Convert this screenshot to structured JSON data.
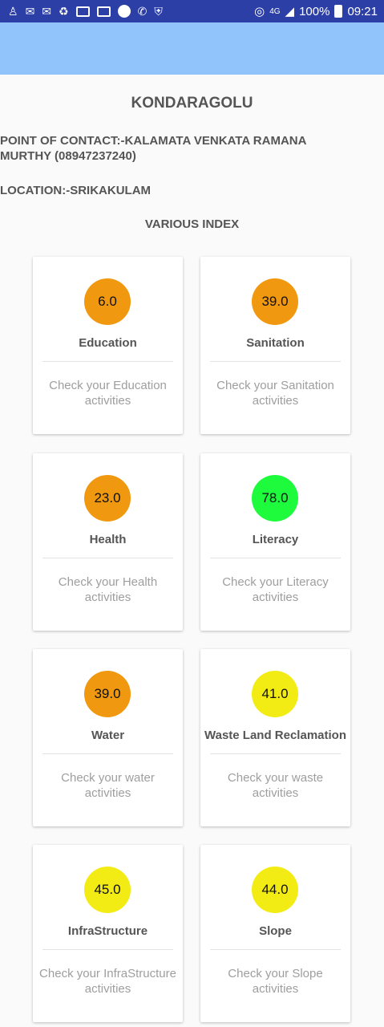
{
  "status_bar": {
    "network": "4G",
    "battery": "100%",
    "time": "09:21"
  },
  "village": {
    "title": "KONDARAGOLU",
    "contact": "POINT OF CONTACT:-KALAMATA VENKATA RAMANA MURTHY (08947237240)",
    "location": "LOCATION:-SRIKAKULAM",
    "index_heading": "VARIOUS INDEX"
  },
  "colors": {
    "status_bar": "#2b3fa6",
    "app_bar": "#90c4fb",
    "orange": "#f0980f",
    "green": "#1dfb3c",
    "yellow": "#f3ec14"
  },
  "indices": [
    {
      "name": "Education",
      "value": "6.0",
      "color": "#f0980f",
      "desc": "Check your Education activities"
    },
    {
      "name": "Sanitation",
      "value": "39.0",
      "color": "#f0980f",
      "desc": "Check your Sanitation activities"
    },
    {
      "name": "Health",
      "value": "23.0",
      "color": "#f0980f",
      "desc": "Check your Health activities"
    },
    {
      "name": "Literacy",
      "value": "78.0",
      "color": "#1dfb3c",
      "desc": "Check your Literacy activities"
    },
    {
      "name": "Water",
      "value": "39.0",
      "color": "#f0980f",
      "desc": "Check your water activities"
    },
    {
      "name": "Waste Land Reclamation",
      "value": "41.0",
      "color": "#f3ec14",
      "desc": "Check your waste activities"
    },
    {
      "name": "InfraStructure",
      "value": "45.0",
      "color": "#f3ec14",
      "desc": "Check your InfraStructure activities"
    },
    {
      "name": "Slope",
      "value": "44.0",
      "color": "#f3ec14",
      "desc": "Check your Slope activities"
    }
  ]
}
